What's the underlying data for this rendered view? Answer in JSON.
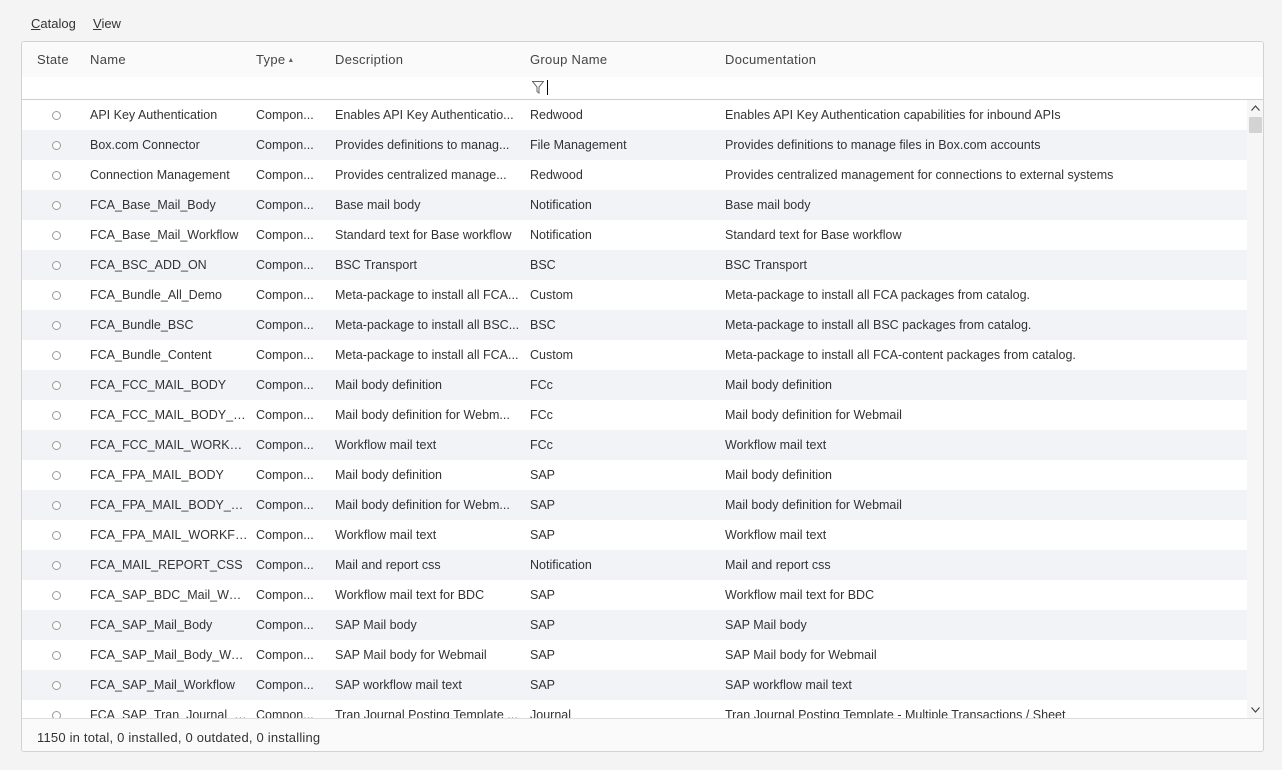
{
  "menu": [
    {
      "first": "C",
      "rest": "atalog"
    },
    {
      "first": "V",
      "rest": "iew"
    }
  ],
  "columns": {
    "state": "State",
    "name": "Name",
    "type": "Type",
    "description": "Description",
    "group": "Group Name",
    "documentation": "Documentation"
  },
  "filter": {
    "icon": "funnel-icon",
    "value": ""
  },
  "rows": [
    {
      "name": "API Key Authentication",
      "type": "Compon...",
      "description": "Enables API Key Authenticatio...",
      "group": "Redwood",
      "documentation": "Enables API Key Authentication capabilities for inbound APIs"
    },
    {
      "name": "Box.com Connector",
      "type": "Compon...",
      "description": "Provides definitions to manag...",
      "group": "File Management",
      "documentation": "Provides definitions to manage files in Box.com accounts"
    },
    {
      "name": "Connection Management",
      "type": "Compon...",
      "description": "Provides centralized manage...",
      "group": "Redwood",
      "documentation": "Provides centralized management for connections to external systems"
    },
    {
      "name": "FCA_Base_Mail_Body",
      "type": "Compon...",
      "description": "Base mail body",
      "group": "Notification",
      "documentation": "Base mail body"
    },
    {
      "name": "FCA_Base_Mail_Workflow",
      "type": "Compon...",
      "description": "Standard text for Base workflow",
      "group": "Notification",
      "documentation": "Standard text for Base workflow"
    },
    {
      "name": "FCA_BSC_ADD_ON",
      "type": "Compon...",
      "description": "BSC Transport",
      "group": "BSC",
      "documentation": "BSC Transport"
    },
    {
      "name": "FCA_Bundle_All_Demo",
      "type": "Compon...",
      "description": "Meta-package to install all FCA...",
      "group": "Custom",
      "documentation": "Meta-package to install all FCA packages from catalog."
    },
    {
      "name": "FCA_Bundle_BSC",
      "type": "Compon...",
      "description": "Meta-package to install all BSC...",
      "group": "BSC",
      "documentation": "Meta-package to install all BSC packages from catalog."
    },
    {
      "name": "FCA_Bundle_Content",
      "type": "Compon...",
      "description": "Meta-package to install all FCA...",
      "group": "Custom",
      "documentation": "Meta-package to install all FCA-content packages from catalog."
    },
    {
      "name": "FCA_FCC_MAIL_BODY",
      "type": "Compon...",
      "description": "Mail body definition",
      "group": "FCc",
      "documentation": "Mail body definition"
    },
    {
      "name": "FCA_FCC_MAIL_BODY_W...",
      "type": "Compon...",
      "description": "Mail body definition for Webm...",
      "group": "FCc",
      "documentation": "Mail body definition for Webmail"
    },
    {
      "name": "FCA_FCC_MAIL_WORKFL...",
      "type": "Compon...",
      "description": "Workflow mail text",
      "group": "FCc",
      "documentation": "Workflow mail text"
    },
    {
      "name": "FCA_FPA_MAIL_BODY",
      "type": "Compon...",
      "description": "Mail body definition",
      "group": "SAP",
      "documentation": "Mail body definition"
    },
    {
      "name": "FCA_FPA_MAIL_BODY_WE...",
      "type": "Compon...",
      "description": "Mail body definition for Webm...",
      "group": "SAP",
      "documentation": "Mail body definition for Webmail"
    },
    {
      "name": "FCA_FPA_MAIL_WORKFL...",
      "type": "Compon...",
      "description": "Workflow mail text",
      "group": "SAP",
      "documentation": "Workflow mail text"
    },
    {
      "name": "FCA_MAIL_REPORT_CSS",
      "type": "Compon...",
      "description": "Mail and report css",
      "group": "Notification",
      "documentation": "Mail and report css"
    },
    {
      "name": "FCA_SAP_BDC_Mail_Work...",
      "type": "Compon...",
      "description": "Workflow mail text for BDC",
      "group": "SAP",
      "documentation": "Workflow mail text for BDC"
    },
    {
      "name": "FCA_SAP_Mail_Body",
      "type": "Compon...",
      "description": "SAP Mail body",
      "group": "SAP",
      "documentation": "SAP Mail body"
    },
    {
      "name": "FCA_SAP_Mail_Body_Web...",
      "type": "Compon...",
      "description": "SAP Mail body for Webmail",
      "group": "SAP",
      "documentation": "SAP Mail body for Webmail"
    },
    {
      "name": "FCA_SAP_Mail_Workflow",
      "type": "Compon...",
      "description": "SAP workflow mail text",
      "group": "SAP",
      "documentation": "SAP workflow mail text"
    },
    {
      "name": "FCA_SAP_Tran_Journal_P...",
      "type": "Compon...",
      "description": "Tran Journal Posting Template ...",
      "group": "Journal",
      "documentation": "Tran Journal Posting Template - Multiple Transactions / Sheet"
    }
  ],
  "status": "1150 in total, 0 installed, 0 outdated, 0 installing",
  "icons": {
    "sort": "sort-ascending-icon",
    "scroll_up": "chevron-up-icon",
    "scroll_down": "chevron-down-icon"
  }
}
